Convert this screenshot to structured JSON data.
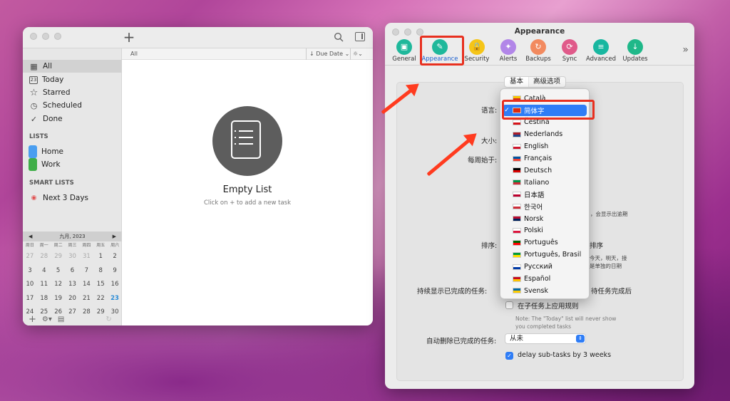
{
  "left_window": {
    "toolbar": {
      "add_label": "+"
    },
    "sidebar": {
      "items": [
        {
          "label": "All",
          "icon": "grid-icon"
        },
        {
          "label": "Today",
          "icon": "calendar-23-icon"
        },
        {
          "label": "Starred",
          "icon": "star-icon"
        },
        {
          "label": "Scheduled",
          "icon": "clock-icon"
        },
        {
          "label": "Done",
          "icon": "check-circle-icon"
        }
      ],
      "lists_header": "LISTS",
      "lists": [
        {
          "label": "Home",
          "color": "#4a9ef0"
        },
        {
          "label": "Work",
          "color": "#3fae48"
        }
      ],
      "smart_header": "SMART LISTS",
      "smart": [
        {
          "label": "Next 3 Days"
        }
      ],
      "calendar": {
        "month": "九月, 2023",
        "weekdays": [
          "周日",
          "周一",
          "周二",
          "周三",
          "周四",
          "周五",
          "周六"
        ],
        "weeks": [
          [
            "27",
            "28",
            "29",
            "30",
            "31",
            "1",
            "2"
          ],
          [
            "3",
            "4",
            "5",
            "6",
            "7",
            "8",
            "9"
          ],
          [
            "10",
            "11",
            "12",
            "13",
            "14",
            "15",
            "16"
          ],
          [
            "17",
            "18",
            "19",
            "20",
            "21",
            "22",
            "23"
          ],
          [
            "24",
            "25",
            "26",
            "27",
            "28",
            "29",
            "30"
          ]
        ],
        "today": "23"
      }
    },
    "main": {
      "header_label": "All",
      "sort_label": "Due Date",
      "empty_title": "Empty List",
      "empty_subtitle": "Click on + to add a new task"
    }
  },
  "right_window": {
    "title": "Appearance",
    "toolbar": [
      {
        "label": "General",
        "color": "#1fb89b"
      },
      {
        "label": "Appearance",
        "color": "#1fb89b"
      },
      {
        "label": "Security",
        "color": "#f5c518"
      },
      {
        "label": "Alerts",
        "color": "#b286e8"
      },
      {
        "label": "Backups",
        "color": "#f28a5f"
      },
      {
        "label": "Sync",
        "color": "#e05a8a"
      },
      {
        "label": "Advanced",
        "color": "#18b7a0"
      },
      {
        "label": "Updates",
        "color": "#1fb889"
      }
    ],
    "tabs": [
      "基本",
      "高级选项"
    ],
    "labels": {
      "language": "语言:",
      "size": "大小:",
      "week_start": "每周始于:",
      "order": "排序:",
      "show_completed": "持续显示已完成的任务:",
      "apply_subtasks": "在子任务上应用规则",
      "auto_delete": "自动删除已完成的任务:",
      "delay": "delay sub-tasks by 3 weeks"
    },
    "partial_texts": {
      "show_overdue": "，会显示出逾期",
      "order_rule": "排序",
      "order_note1": "今天，明天，接",
      "order_note2": "是单独的日期",
      "pending_done": "待任务完成后"
    },
    "note_lines": [
      "Note: The \"Today\" list will never show",
      "you completed tasks"
    ],
    "auto_delete_value": "从未",
    "languages": [
      "Català",
      "简体字",
      "Čeština",
      "Nederlands",
      "English",
      "Français",
      "Deutsch",
      "Italiano",
      "日本語",
      "한국어",
      "Norsk",
      "Polski",
      "Português",
      "Português, Brasil",
      "Русский",
      "Español",
      "Svensk"
    ],
    "selected_language": "简体字"
  }
}
